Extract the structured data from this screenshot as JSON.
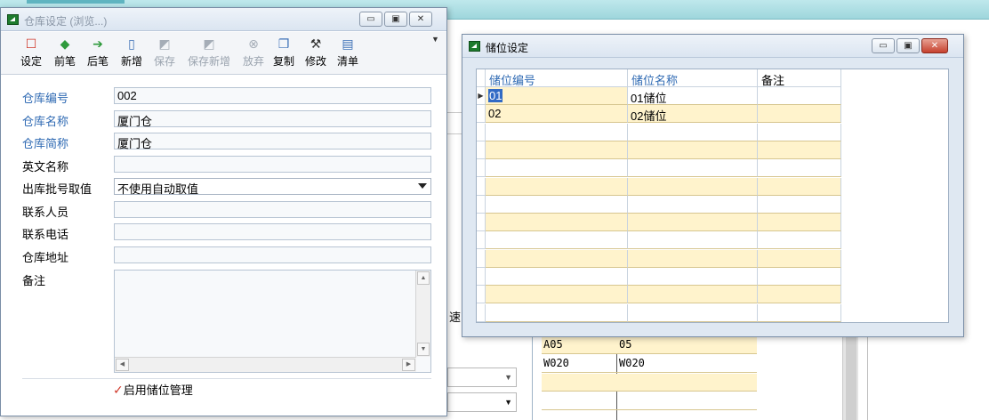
{
  "bg_app": {
    "grid_rows": [
      {
        "code": "A05",
        "name": "05"
      },
      {
        "code": "W020",
        "name": "W020"
      },
      {
        "code": "",
        "name": ""
      },
      {
        "code": "",
        "name": ""
      }
    ],
    "partial_text_1": "速"
  },
  "warehouse_window": {
    "title": "仓库设定 (浏览...)",
    "toolbar": [
      {
        "label": "设定",
        "icon": "settings-icon",
        "glyph": "☐",
        "color": "#d0392b",
        "enabled": true
      },
      {
        "label": "前笔",
        "icon": "previous-icon",
        "glyph": "◆",
        "color": "#2e9a3c",
        "enabled": true
      },
      {
        "label": "后笔",
        "icon": "next-icon",
        "glyph": "➔",
        "color": "#2e9a3c",
        "enabled": true
      },
      {
        "label": "新增",
        "icon": "new-document-icon",
        "glyph": "▯",
        "color": "#3b6fb6",
        "enabled": true
      },
      {
        "label": "保存",
        "icon": "save-icon",
        "glyph": "◩",
        "color": "#a5adb7",
        "enabled": false
      },
      {
        "label": "保存新增",
        "icon": "save-new-icon",
        "glyph": "◩",
        "color": "#a5adb7",
        "enabled": false
      },
      {
        "label": "放弃",
        "icon": "discard-icon",
        "glyph": "⊗",
        "color": "#a5adb7",
        "enabled": false
      },
      {
        "label": "复制",
        "icon": "copy-icon",
        "glyph": "❐",
        "color": "#3b6fb6",
        "enabled": true
      },
      {
        "label": "修改",
        "icon": "edit-tools-icon",
        "glyph": "⚒",
        "color": "#333333",
        "enabled": true
      },
      {
        "label": "清单",
        "icon": "list-icon",
        "glyph": "▤",
        "color": "#3b6fb6",
        "enabled": true
      }
    ],
    "fields": [
      {
        "label": "仓库编号",
        "value": "002",
        "required": true
      },
      {
        "label": "仓库名称",
        "value": "厦门仓",
        "required": true
      },
      {
        "label": "仓库简称",
        "value": "厦门仓",
        "required": true
      },
      {
        "label": "英文名称",
        "value": "",
        "required": false
      },
      {
        "label": "出库批号取值",
        "value": "不使用自动取值",
        "required": false,
        "combo": true
      },
      {
        "label": "联系人员",
        "value": "",
        "required": false
      },
      {
        "label": "联系电话",
        "value": "",
        "required": false
      },
      {
        "label": "仓库地址",
        "value": "",
        "required": false
      }
    ],
    "memo_label": "备注",
    "memo_value": "",
    "enable_bin_label": "启用储位管理",
    "enable_bin_checked": true
  },
  "bin_window": {
    "title": "储位设定",
    "columns": [
      "储位编号",
      "储位名称",
      "备注"
    ],
    "rows": [
      {
        "code": "01",
        "name": "01储位",
        "note": ""
      },
      {
        "code": "02",
        "name": "02储位",
        "note": ""
      }
    ],
    "empty_rows": 11,
    "current_row_indicator": "▶"
  },
  "colors": {
    "required_label": "#2f6ab3",
    "grid_alt_row": "#fff3cc",
    "selection": "#316ac5"
  }
}
